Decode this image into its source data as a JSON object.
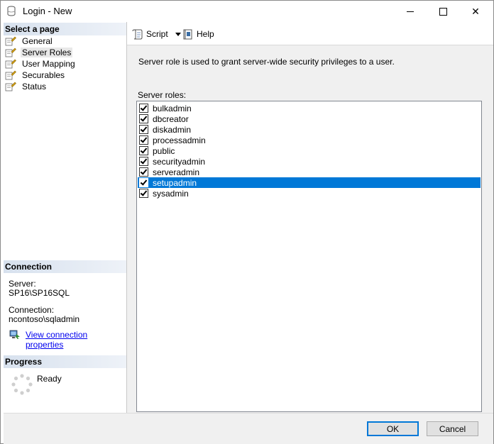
{
  "window": {
    "title": "Login - New",
    "min_symbol": "",
    "close_symbol": "✕"
  },
  "left_pane": {
    "select_page_header": "Select a page",
    "pages": [
      {
        "label": "General",
        "icon": "page-wrench-icon"
      },
      {
        "label": "Server Roles",
        "icon": "page-wrench-icon",
        "selected": true
      },
      {
        "label": "User Mapping",
        "icon": "page-wrench-icon"
      },
      {
        "label": "Securables",
        "icon": "page-wrench-icon"
      },
      {
        "label": "Status",
        "icon": "page-wrench-icon"
      }
    ],
    "connection_header": "Connection",
    "server_label": "Server:",
    "server_value": "SP16\\SP16SQL",
    "connection_label": "Connection:",
    "connection_value": "ncontoso\\sqladmin",
    "view_connection_link": "View connection properties",
    "progress_header": "Progress",
    "progress_status": "Ready"
  },
  "toolbar": {
    "script_label": "Script",
    "help_label": "Help"
  },
  "main": {
    "description": "Server role is used to grant server-wide security privileges to a user.",
    "roles_label": "Server roles:",
    "roles": [
      {
        "name": "bulkadmin",
        "checked": true
      },
      {
        "name": "dbcreator",
        "checked": true
      },
      {
        "name": "diskadmin",
        "checked": true
      },
      {
        "name": "processadmin",
        "checked": true
      },
      {
        "name": "public",
        "checked": true
      },
      {
        "name": "securityadmin",
        "checked": true
      },
      {
        "name": "serveradmin",
        "checked": true
      },
      {
        "name": "setupadmin",
        "checked": true,
        "selected": true
      },
      {
        "name": "sysadmin",
        "checked": true
      }
    ]
  },
  "buttons": {
    "ok": "OK",
    "cancel": "Cancel"
  },
  "colors": {
    "selection": "#0078d7",
    "link": "#0000ee"
  }
}
